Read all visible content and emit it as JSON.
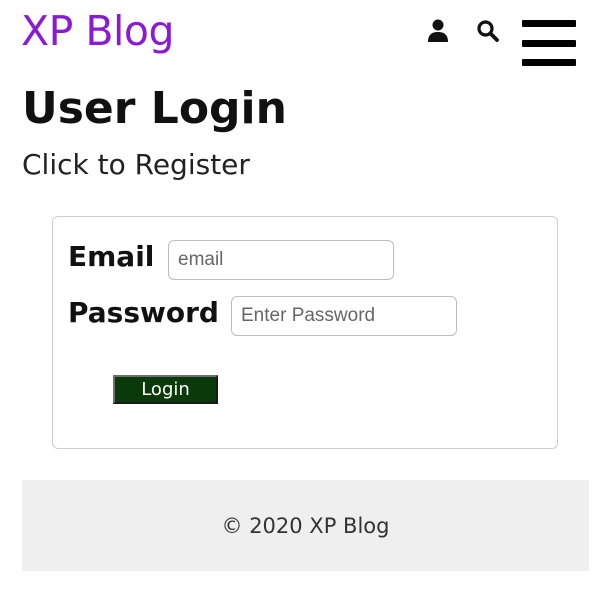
{
  "header": {
    "brand": "XP Blog",
    "icons": [
      "user-icon",
      "search-icon",
      "hamburger-menu-icon"
    ]
  },
  "main": {
    "title": "User Login",
    "register_link": "Click to Register"
  },
  "login_form": {
    "email_label": "Email",
    "email_placeholder": "email",
    "password_label": "Password",
    "password_placeholder": "Enter Password",
    "submit_label": "Login"
  },
  "footer": {
    "text": "© 2020 XP Blog"
  },
  "colors": {
    "brand": "#8b1bd2",
    "login_button_bg": "#0a3a0a",
    "footer_bg": "#efefef"
  }
}
